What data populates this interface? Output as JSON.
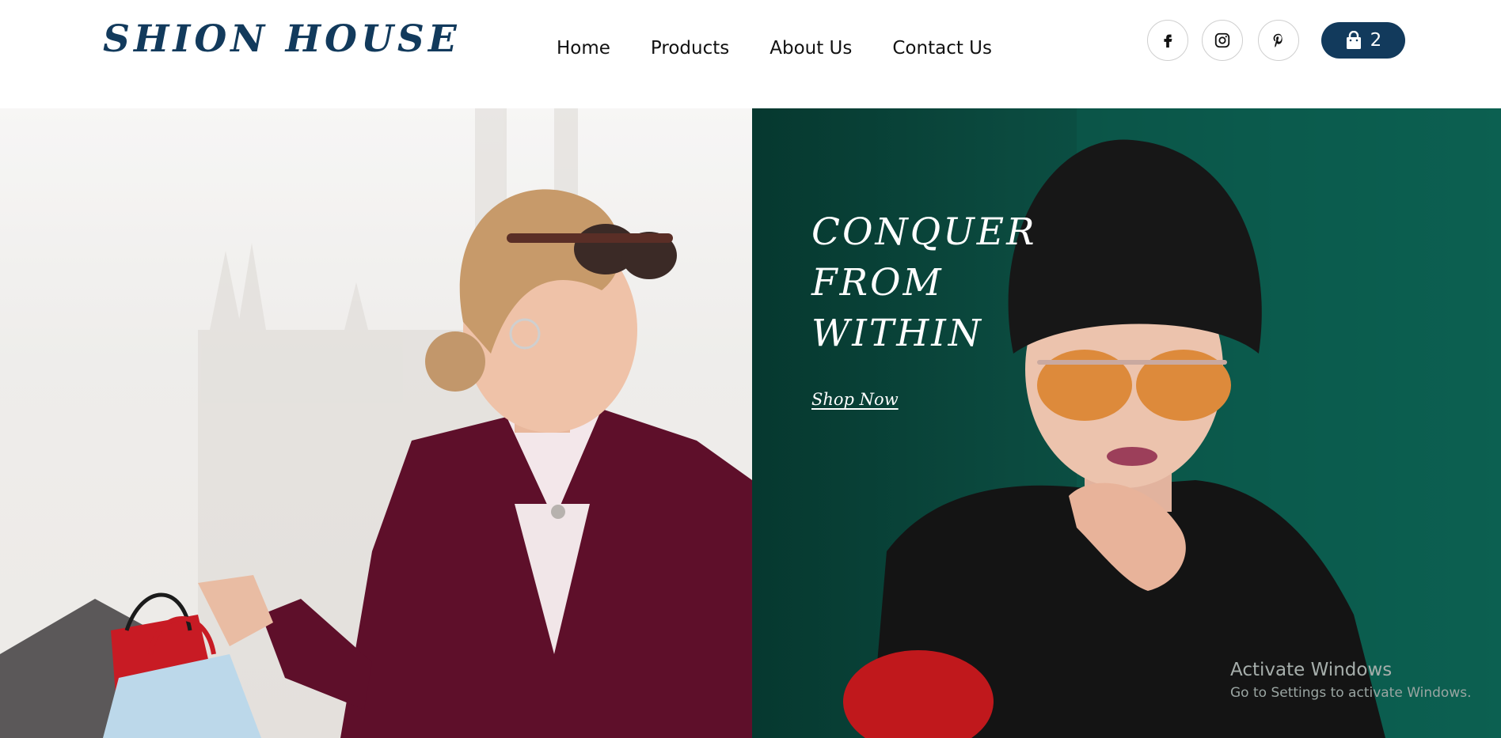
{
  "brand": {
    "logo_text": "SHION HOUSE",
    "color": "#123a5c"
  },
  "nav": {
    "items": [
      {
        "label": "Home"
      },
      {
        "label": "Products"
      },
      {
        "label": "About Us"
      },
      {
        "label": "Contact Us"
      }
    ]
  },
  "social": [
    {
      "icon": "facebook-icon"
    },
    {
      "icon": "instagram-icon"
    },
    {
      "icon": "pinterest-icon"
    }
  ],
  "cart": {
    "icon": "shopping-bag-icon",
    "count": "2"
  },
  "hero": {
    "left_image": "woman-with-shopping-bags-photo",
    "right_image": "woman-in-beanie-and-sunglasses-photo",
    "headline_lines": [
      "CONQUER",
      "FROM",
      "WITHIN"
    ],
    "cta_label": "Shop Now",
    "accent_bg": "#0b4a3f"
  },
  "os_watermark": {
    "title": "Activate Windows",
    "subtitle": "Go to Settings to activate Windows."
  }
}
